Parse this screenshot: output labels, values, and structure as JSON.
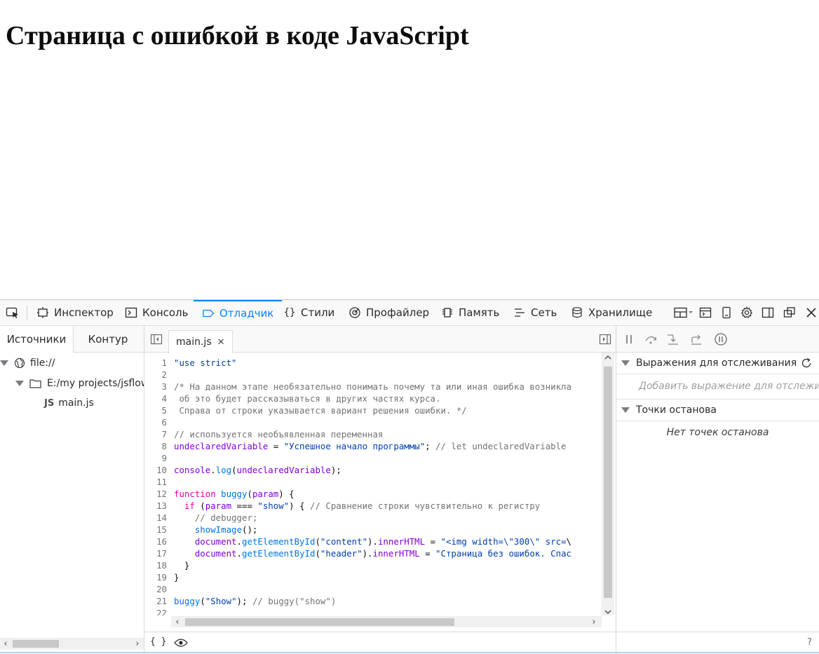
{
  "page": {
    "heading": "Страница с ошибкой в коде JavaScript"
  },
  "toolbar": {
    "tabs": [
      {
        "label": "Инспектор",
        "icon": "inspector-icon"
      },
      {
        "label": "Консоль",
        "icon": "console-icon"
      },
      {
        "label": "Отладчик",
        "icon": "debugger-icon",
        "active": true
      },
      {
        "label": "Стили",
        "icon": "style-editor-icon"
      },
      {
        "label": "Профайлер",
        "icon": "profiler-icon"
      },
      {
        "label": "Память",
        "icon": "memory-icon"
      },
      {
        "label": "Сеть",
        "icon": "network-icon"
      },
      {
        "label": "Хранилище",
        "icon": "storage-icon"
      }
    ],
    "accent_color": "#0a84ff"
  },
  "sources": {
    "tabs": [
      "Источники",
      "Контур"
    ],
    "tree": {
      "root": "file://",
      "folder": "E:/my projects/jsflow",
      "file_badge": "JS",
      "file": "main.js"
    }
  },
  "editor": {
    "file_tab": "main.js",
    "footer_braces": "{ }"
  },
  "code": [
    {
      "n": "1",
      "t": "\"use strict\""
    },
    {
      "n": "2",
      "t": ""
    },
    {
      "n": "3",
      "t": "/* На данном этапе необязательно понимать почему та или иная ошибка возникла"
    },
    {
      "n": "4",
      "t": " об это будет рассказываться в других частях курса."
    },
    {
      "n": "5",
      "t": " Справа от строки указывается вариант решения ошибки. */"
    },
    {
      "n": "6",
      "t": ""
    },
    {
      "n": "7",
      "t": "// используется необъявленная переменная"
    },
    {
      "n": "8",
      "t": "undeclaredVariable = \"Успешное начало программы\"; // let undeclaredVariable"
    },
    {
      "n": "9",
      "t": ""
    },
    {
      "n": "10",
      "t": "console.log(undeclaredVariable);"
    },
    {
      "n": "11",
      "t": ""
    },
    {
      "n": "12",
      "t": "function buggy(param) {"
    },
    {
      "n": "13",
      "t": "  if (param === \"show\") { // Сравнение строки чувствительно к регистру"
    },
    {
      "n": "14",
      "t": "    // debugger;"
    },
    {
      "n": "15",
      "t": "    showImage();"
    },
    {
      "n": "16",
      "t": "    document.getElementById(\"content\").innerHTML = \"<img width=\\\"300\\\" src=\\"
    },
    {
      "n": "17",
      "t": "    document.getElementById(\"header\").innerHTML = \"Страница без ошибок. Спас"
    },
    {
      "n": "18",
      "t": "  }"
    },
    {
      "n": "19",
      "t": "}"
    },
    {
      "n": "20",
      "t": ""
    },
    {
      "n": "21",
      "t": "buggy(\"Show\"); // buggy(\"show\")"
    },
    {
      "n": "22",
      "t": ""
    }
  ],
  "debugger": {
    "watch_title": "Выражения для отслеживания",
    "watch_placeholder": "Добавить выражение для отслеживания",
    "breakpoints_title": "Точки останова",
    "no_breakpoints": "Нет точек останова",
    "help": "?"
  }
}
